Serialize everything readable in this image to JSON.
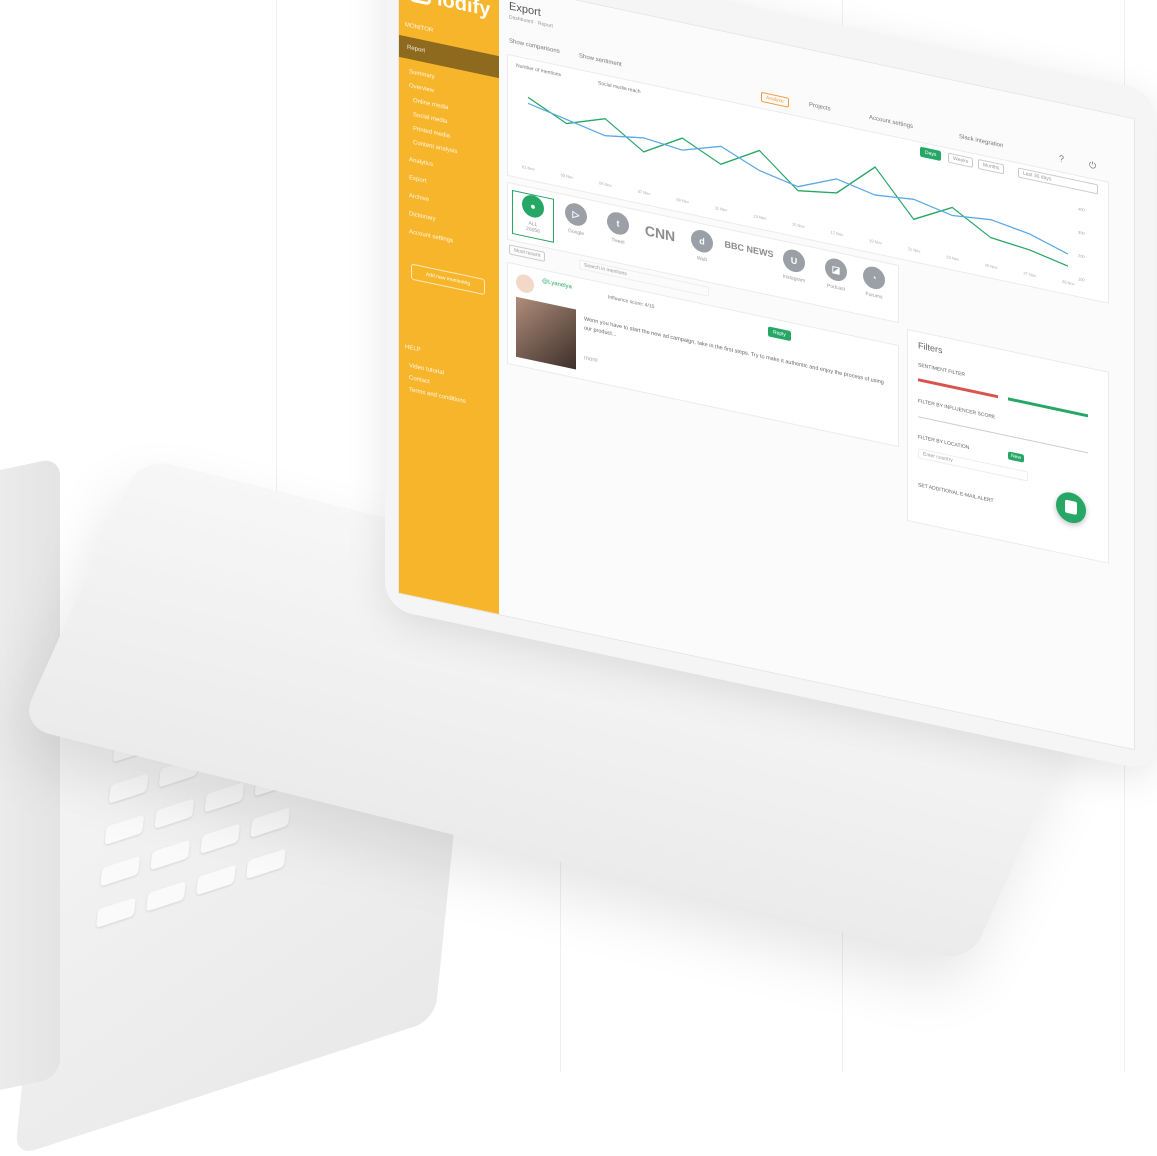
{
  "app": {
    "brand": "lodify",
    "brand_color": "#f7b52b",
    "accent_color": "#27a766",
    "page_title": "Export",
    "breadcrumb": "Dashboard · Report"
  },
  "sidebar": {
    "section_label": "MONITOR",
    "active_item": "Report",
    "items": [
      "Summary",
      "Overview",
      "Online media",
      "Social media",
      "Printed media",
      "Content analysis",
      "Analytics",
      "Export",
      "Archive",
      "Dictionary",
      "Account settings"
    ],
    "add_button": "Add new monitoring",
    "footer_label": "HELP",
    "footer_items": [
      "Video tutorial",
      "Contact",
      "Terms and conditions"
    ]
  },
  "toolbar": {
    "show_comparison": "Show comparisons",
    "show_sentiment": "Show sentiment",
    "analyze_label": "Analyze",
    "projects_label": "Projects",
    "account_settings": "Account settings",
    "slack_label": "Slack integration"
  },
  "chart_controls": {
    "legend": [
      "Number of mentions",
      "Social media reach"
    ],
    "range_buttons": [
      "Days",
      "Weeks",
      "Months"
    ],
    "date_range": "Last 30 days"
  },
  "chart_data": {
    "type": "line",
    "x": [
      "01 Nov",
      "03 Nov",
      "05 Nov",
      "07 Nov",
      "09 Nov",
      "11 Nov",
      "13 Nov",
      "15 Nov",
      "17 Nov",
      "19 Nov",
      "21 Nov",
      "23 Nov",
      "25 Nov",
      "27 Nov",
      "29 Nov"
    ],
    "series": [
      {
        "name": "Number of mentions",
        "color": "#27a766",
        "values": [
          60,
          42,
          55,
          30,
          52,
          34,
          56,
          24,
          30,
          64,
          20,
          40,
          18,
          14,
          6
        ]
      },
      {
        "name": "Social media reach",
        "color": "#5aa8e6",
        "values": [
          54,
          46,
          38,
          44,
          40,
          52,
          36,
          28,
          44,
          36,
          40,
          32,
          36,
          30,
          18
        ]
      }
    ],
    "y_right_ticks": [
      "400",
      "300",
      "200",
      "100"
    ]
  },
  "sources": {
    "all_label": "ALL",
    "all_count": "26056",
    "items": [
      {
        "name": "Google",
        "icon": "play-icon"
      },
      {
        "name": "Tweet",
        "icon": "twitter-icon"
      },
      {
        "name": "CNN",
        "icon": "cnn-logo"
      },
      {
        "name": "Web",
        "icon": "web-icon"
      },
      {
        "name": "BBC NEWS",
        "icon": "bbc-logo"
      },
      {
        "name": "Instagram",
        "icon": "u-icon"
      },
      {
        "name": "Podcast",
        "icon": "podcast-icon"
      },
      {
        "name": "Forums",
        "icon": "forum-icon"
      }
    ],
    "sort_label": "Most recent",
    "search_placeholder": "Search in mentions"
  },
  "feed": {
    "author": "@Lyanelya",
    "meta": "Influence score: 4/10",
    "text": "Wenn you have to start the new ad campaign, take in the first steps. Try to make it authentic and enjoy the process of using our product...",
    "tag_button": "Reply",
    "more": "more"
  },
  "filters": {
    "title": "Filters",
    "sentiment": "SENTIMENT FILTER",
    "influence": "FILTER BY INFLUENCER SCORE",
    "location": "FILTER BY LOCATION",
    "location_badge": "New",
    "location_placeholder": "Enter country",
    "additional": "SET ADDITIONAL E-MAIL ALERT",
    "scale": [
      "1",
      "2",
      "3",
      "4",
      "5",
      "6",
      "7",
      "8",
      "9",
      "10"
    ]
  }
}
